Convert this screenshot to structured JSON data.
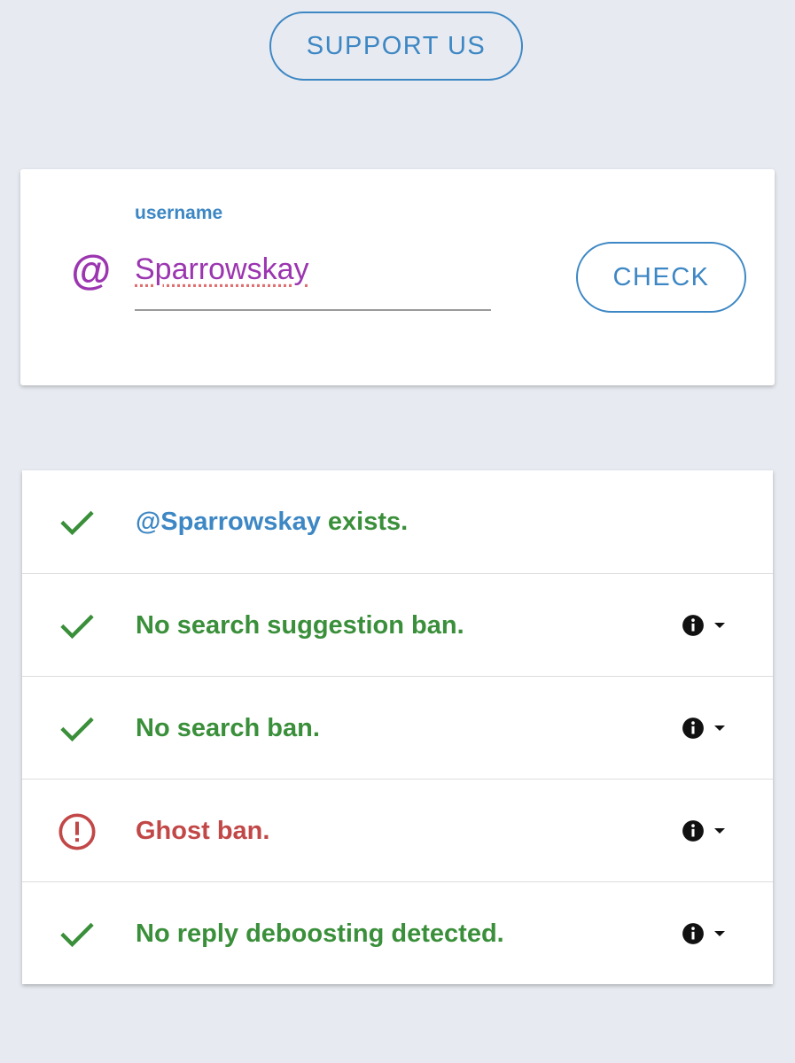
{
  "header": {
    "support_label": "SUPPORT US"
  },
  "username_card": {
    "field_label": "username",
    "at_symbol": "@",
    "username_value": "Sparrowskay",
    "check_label": "CHECK"
  },
  "results": {
    "rows": [
      {
        "status": "ok",
        "icon": "check-icon",
        "handle": "@Sparrowskay",
        "text": " exists."
      },
      {
        "status": "ok",
        "icon": "check-icon",
        "text": "No search suggestion ban.",
        "has_info": true
      },
      {
        "status": "ok",
        "icon": "check-icon",
        "text": "No search ban.",
        "has_info": true
      },
      {
        "status": "alert",
        "icon": "alert-circle-icon",
        "text": "Ghost ban.",
        "has_info": true
      },
      {
        "status": "ok",
        "icon": "check-icon",
        "text": "No reply deboosting detected.",
        "has_info": true
      }
    ]
  },
  "colors": {
    "background": "#e7eaf0",
    "accent_blue": "#3d87c4",
    "username_purple": "#9b35b0",
    "ok_green": "#3a8f3a",
    "alert_red": "#c24747"
  }
}
